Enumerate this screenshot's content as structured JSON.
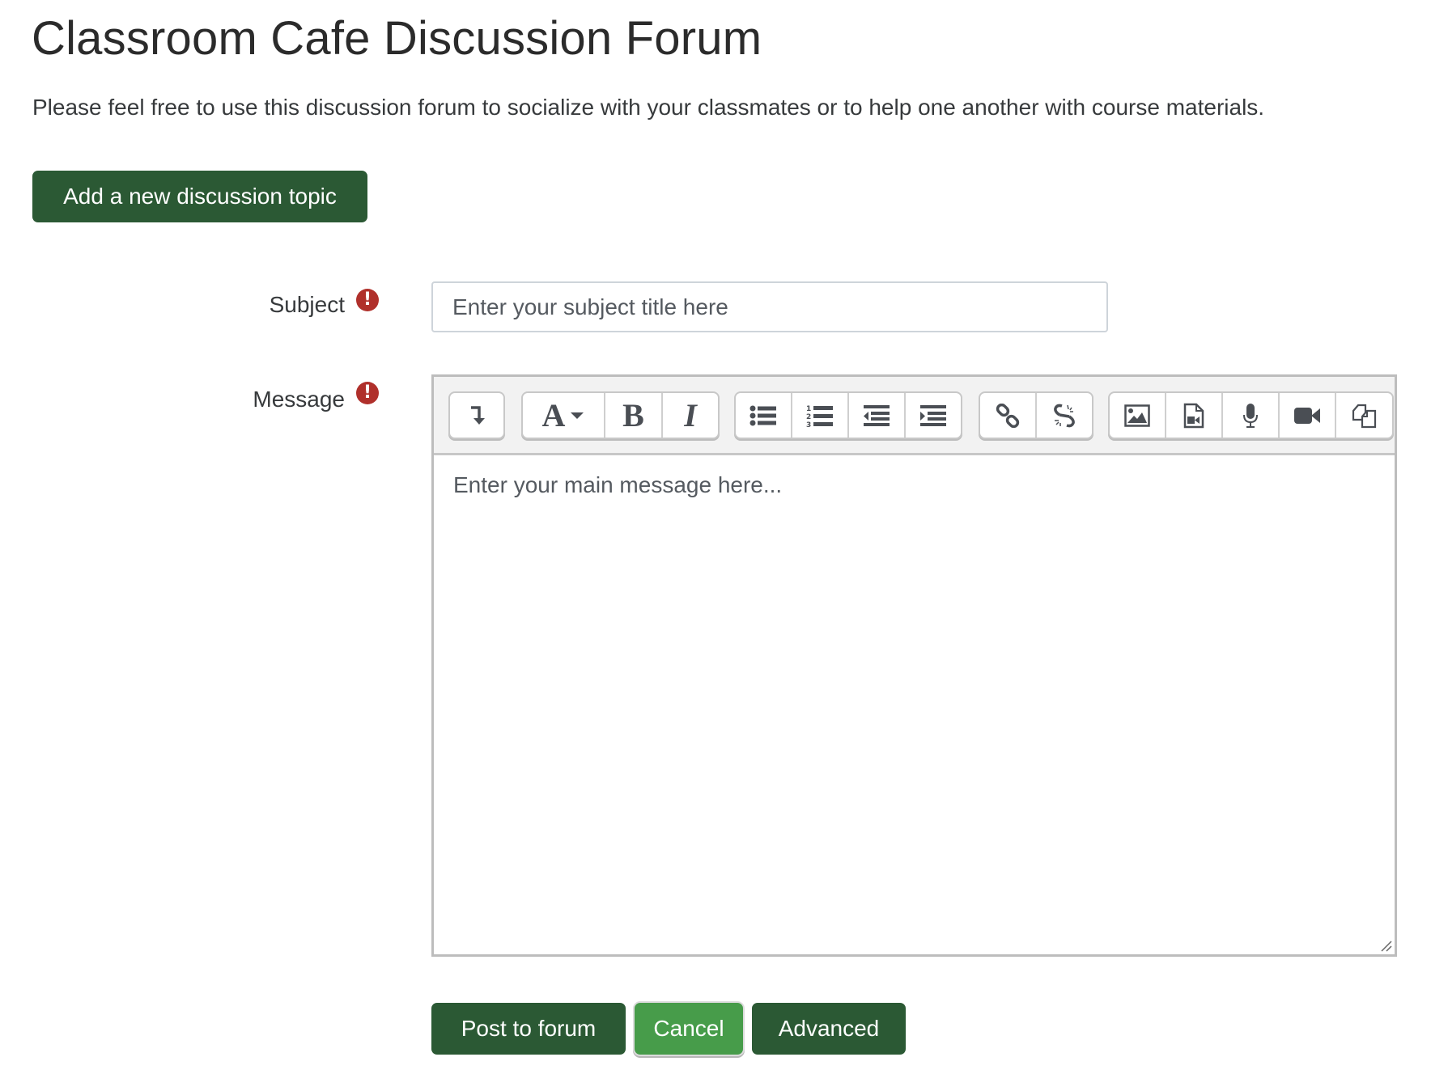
{
  "page": {
    "title": "Classroom Cafe Discussion Forum",
    "description": "Please feel free to use this discussion forum to socialize with your classmates or to help one another with course materials."
  },
  "actions": {
    "add_topic_label": "Add a new discussion topic"
  },
  "form": {
    "subject": {
      "label": "Subject",
      "required": true,
      "required_icon": "exclamation-circle-icon",
      "value": "",
      "placeholder": "Enter your subject title here"
    },
    "message": {
      "label": "Message",
      "required": true,
      "required_icon": "exclamation-circle-icon",
      "value": "",
      "placeholder": "Enter your main message here..."
    }
  },
  "toolbar": {
    "groups": [
      {
        "buttons": [
          {
            "name": "show-more-buttons",
            "icon": "level-down-arrow-icon"
          }
        ]
      },
      {
        "buttons": [
          {
            "name": "font-style",
            "icon": "font-dropdown-icon",
            "label": "A"
          },
          {
            "name": "bold",
            "icon": "bold-icon",
            "label": "B"
          },
          {
            "name": "italic",
            "icon": "italic-icon",
            "label": "I"
          }
        ]
      },
      {
        "buttons": [
          {
            "name": "unordered-list",
            "icon": "bullet-list-icon"
          },
          {
            "name": "ordered-list",
            "icon": "numbered-list-icon"
          },
          {
            "name": "outdent",
            "icon": "outdent-icon"
          },
          {
            "name": "indent",
            "icon": "indent-icon"
          }
        ]
      },
      {
        "buttons": [
          {
            "name": "link",
            "icon": "link-icon"
          },
          {
            "name": "unlink",
            "icon": "unlink-icon"
          }
        ]
      },
      {
        "buttons": [
          {
            "name": "insert-image",
            "icon": "image-icon"
          },
          {
            "name": "insert-media",
            "icon": "file-video-icon"
          },
          {
            "name": "record-audio",
            "icon": "microphone-icon"
          },
          {
            "name": "record-video",
            "icon": "video-camera-icon"
          },
          {
            "name": "manage-files",
            "icon": "files-icon"
          }
        ]
      }
    ]
  },
  "footer": {
    "post_label": "Post to forum",
    "cancel_label": "Cancel",
    "advanced_label": "Advanced"
  },
  "colors": {
    "primary": "#2b5934",
    "secondary": "#479c4a",
    "required": "#b0302b",
    "text": "#373a3c"
  }
}
